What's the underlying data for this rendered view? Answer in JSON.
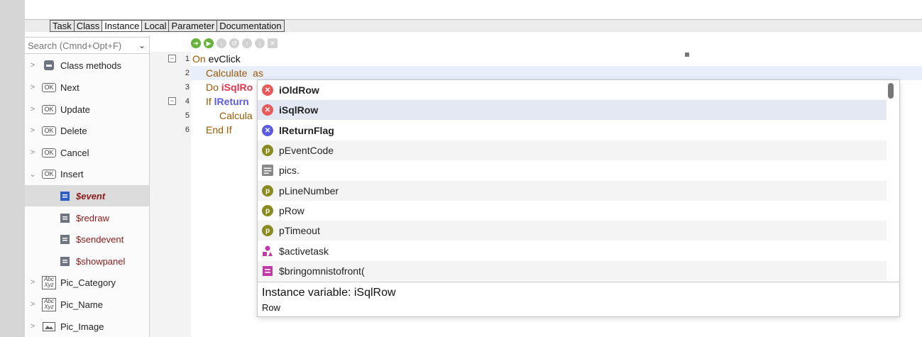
{
  "tabs": [
    "Task",
    "Class",
    "Instance",
    "Local",
    "Parameter",
    "Documentation"
  ],
  "active_tab": "Instance",
  "search": {
    "placeholder": "Search (Cmnd+Opt+F)"
  },
  "sidebar": {
    "items": [
      {
        "label": "Class methods",
        "icon": "class-methods-icon"
      },
      {
        "label": "Next",
        "icon": "ok-button-icon"
      },
      {
        "label": "Update",
        "icon": "ok-button-icon"
      },
      {
        "label": "Delete",
        "icon": "ok-button-icon"
      },
      {
        "label": "Cancel",
        "icon": "ok-button-icon"
      },
      {
        "label": "Insert",
        "icon": "ok-button-icon",
        "expanded": true
      },
      {
        "label": "$event",
        "icon": "method-icon",
        "child": true,
        "selected": true
      },
      {
        "label": "$redraw",
        "icon": "method-icon",
        "child": true
      },
      {
        "label": "$sendevent",
        "icon": "method-icon",
        "child": true
      },
      {
        "label": "$showpanel",
        "icon": "method-icon",
        "child": true
      },
      {
        "label": "Pic_Category",
        "icon": "abc-field-icon"
      },
      {
        "label": "Pic_Name",
        "icon": "abc-field-icon"
      },
      {
        "label": "Pic_Image",
        "icon": "picture-field-icon"
      }
    ]
  },
  "code": {
    "lines": [
      {
        "num": "1",
        "kw": "On",
        "rest": " evClick"
      },
      {
        "num": "2",
        "kw": "Calculate",
        "rest": "  as"
      },
      {
        "num": "3",
        "kw": "Do",
        "var": "iSqlRo"
      },
      {
        "num": "4",
        "kw": "If",
        "var": "lReturn"
      },
      {
        "num": "5",
        "kw": "Calcula",
        "rest": ""
      },
      {
        "num": "6",
        "kw": "End If",
        "rest": ""
      }
    ]
  },
  "popup": {
    "items": [
      {
        "label": "iOldRow",
        "type": "instance"
      },
      {
        "label": "iSqlRow",
        "type": "instance",
        "selected": true
      },
      {
        "label": "lReturnFlag",
        "type": "local"
      },
      {
        "label": "pEventCode",
        "type": "parameter"
      },
      {
        "label": "pics.",
        "type": "table"
      },
      {
        "label": "pLineNumber",
        "type": "parameter"
      },
      {
        "label": "pRow",
        "type": "parameter"
      },
      {
        "label": "pTimeout",
        "type": "parameter"
      },
      {
        "label": "$activetask",
        "type": "shapes"
      },
      {
        "label": "$bringomnistofront(",
        "type": "method"
      }
    ],
    "detail_title": "Instance variable: iSqlRow",
    "detail_sub": "Row"
  },
  "colors": {
    "instance_icon": "#e85a5a",
    "local_icon": "#5b5be0",
    "parameter_icon": "#8a8a1f",
    "table_icon": "#888888",
    "shapes_icon": "#c23aa8",
    "method_icon": "#c23aa8",
    "run_green": "#66b23a"
  }
}
